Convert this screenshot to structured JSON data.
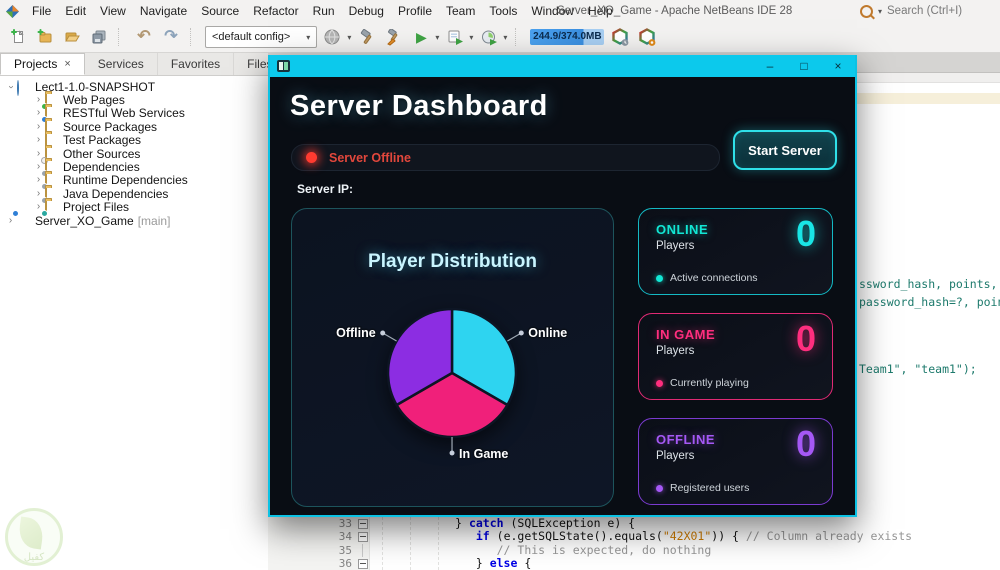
{
  "window": {
    "title": "Server_XO_Game - Apache NetBeans IDE 28"
  },
  "menubar": {
    "items": [
      "File",
      "Edit",
      "View",
      "Navigate",
      "Source",
      "Refactor",
      "Run",
      "Debug",
      "Profile",
      "Team",
      "Tools",
      "Window",
      "Help"
    ],
    "search": "Search (Ctrl+I)"
  },
  "toolbar": {
    "config": "<default config>",
    "memory": "244.9/374.0MB"
  },
  "sidebar": {
    "tabs": [
      {
        "label": "Projects"
      },
      {
        "label": "Services"
      },
      {
        "label": "Favorites"
      },
      {
        "label": "Files"
      }
    ],
    "close_glyph": "×",
    "tree": [
      {
        "label": "Lect1-1.0-SNAPSHOT"
      },
      {
        "label": "Web Pages"
      },
      {
        "label": "RESTful Web Services"
      },
      {
        "label": "Source Packages"
      },
      {
        "label": "Test Packages"
      },
      {
        "label": "Other Sources"
      },
      {
        "label": "Dependencies"
      },
      {
        "label": "Runtime Dependencies"
      },
      {
        "label": "Java Dependencies"
      },
      {
        "label": "Project Files"
      },
      {
        "label": "Server_XO_Game",
        "suffix": "[main]"
      }
    ]
  },
  "dashboard": {
    "controls": {
      "minimize": "–",
      "maximize": "□",
      "close": "×"
    },
    "title": "Server Dashboard",
    "status": "Server Offline",
    "start_button": "Start Server",
    "server_ip_label": "Server IP:",
    "stats": [
      {
        "heading": "ONLINE",
        "sub": "Players",
        "value": "0",
        "caption": "Active connections",
        "accent": "#19e5e5"
      },
      {
        "heading": "IN GAME",
        "sub": "Players",
        "value": "0",
        "caption": "Currently playing",
        "accent": "#ff2e7e"
      },
      {
        "heading": "OFFLINE",
        "sub": "Players",
        "value": "0",
        "caption": "Registered users",
        "accent": "#a558f5"
      }
    ]
  },
  "chart_data": {
    "type": "pie",
    "title": "Player Distribution",
    "labels": [
      "Online",
      "In Game",
      "Offline"
    ],
    "values": [
      33.33,
      33.33,
      33.34
    ],
    "colors": [
      "#2ed4f0",
      "#f0207a",
      "#8c2de2"
    ],
    "legend_position": "callout-labels"
  },
  "editor": {
    "right_lines": [
      {
        "t": "ssword_hash, points, Sta"
      },
      {
        "t": "password_hash=?, points="
      },
      {
        "t": "Team1\", \"team1\");"
      }
    ],
    "bottom_lines": [
      {
        "num": "33",
        "segments": [
          {
            "k": "p",
            "t": "            } "
          },
          {
            "k": "kw",
            "t": "catch"
          },
          {
            "k": "p",
            "t": " (SQLException e) {"
          }
        ]
      },
      {
        "num": "34",
        "segments": [
          {
            "k": "p",
            "t": "               "
          },
          {
            "k": "kw",
            "t": "if"
          },
          {
            "k": "p",
            "t": " (e.getSQLState().equals("
          },
          {
            "k": "str",
            "t": "\"42X01\""
          },
          {
            "k": "p",
            "t": ")) { "
          },
          {
            "k": "cm",
            "t": "// Column already exists"
          }
        ]
      },
      {
        "num": "35",
        "segments": [
          {
            "k": "p",
            "t": "                  "
          },
          {
            "k": "cm",
            "t": "// This is expected, do nothing"
          }
        ]
      },
      {
        "num": "36",
        "segments": [
          {
            "k": "p",
            "t": "               } "
          },
          {
            "k": "kw",
            "t": "else"
          },
          {
            "k": "p",
            "t": " {"
          }
        ]
      }
    ]
  },
  "watermark": {
    "text": "كفيل"
  },
  "colors": {
    "titlebar_cyan": "#0cc9ec",
    "status_red": "#e2473c",
    "accent_cyan": "#19e5e5",
    "accent_pink": "#ff2e7e",
    "accent_purple": "#a558f5",
    "keyword_blue": "#0000e6",
    "string_orange": "#ce7b00",
    "comment_gray": "#969696",
    "sql_teal": "#1d7a6c"
  }
}
